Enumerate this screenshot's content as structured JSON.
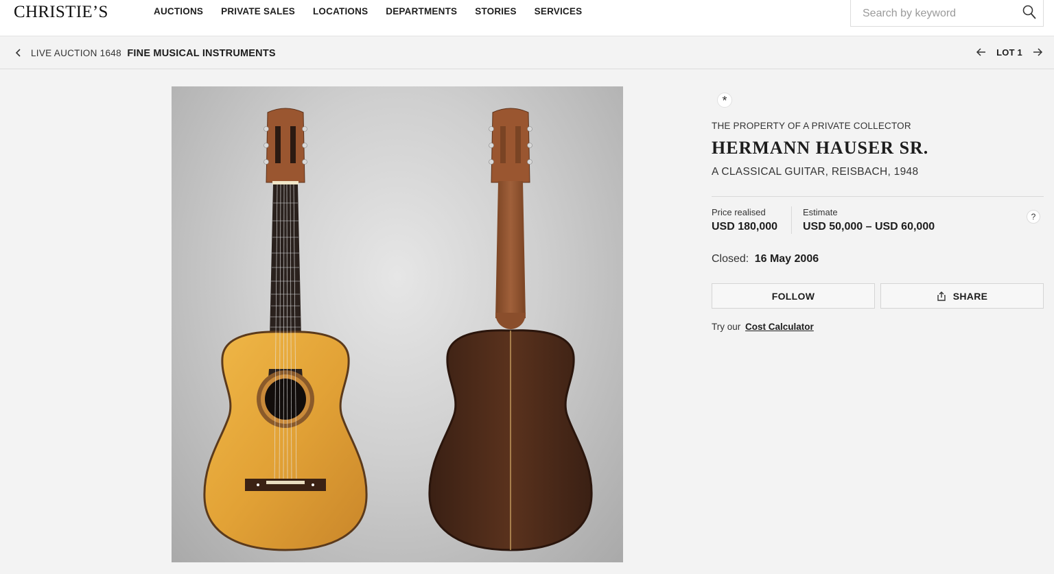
{
  "header": {
    "logo": "CHRISTIE’S",
    "nav": [
      "AUCTIONS",
      "PRIVATE SALES",
      "LOCATIONS",
      "DEPARTMENTS",
      "STORIES",
      "SERVICES"
    ],
    "search": {
      "placeholder": "Search by keyword",
      "value": "",
      "icon": "search-icon"
    }
  },
  "breadcrumb": {
    "back_icon": "chevron-left-icon",
    "prefix": "LIVE AUCTION 1648",
    "title": "FINE MUSICAL INSTRUMENTS"
  },
  "lot_nav": {
    "prev_icon": "arrow-left-icon",
    "label": "LOT 1",
    "next_icon": "arrow-right-icon"
  },
  "image": {
    "alt_icon": "guitar-photo",
    "background": "#c9c9c9"
  },
  "lot": {
    "badge": "*",
    "provenance": "THE PROPERTY OF A PRIVATE COLLECTOR",
    "title": "HERMANN HAUSER SR.",
    "subtitle": "A CLASSICAL GUITAR, REISBACH, 1948",
    "price_label": "Price realised",
    "price_value": "USD 180,000",
    "estimate_label": "Estimate",
    "estimate_value": "USD 50,000 – USD 60,000",
    "help": "?",
    "closed_label": "Closed:",
    "closed_date": "16 May 2006",
    "follow_label": "FOLLOW",
    "share_label": "SHARE",
    "share_icon": "share-icon",
    "calc_prefix": "Try our",
    "calc_link": "Cost Calculator"
  },
  "colors": {
    "page_bg": "#f3f3f3",
    "header_bg": "#ffffff",
    "text": "#1d1d1d",
    "guitar_top": "#e0a53a",
    "guitar_back": "#4a2a1a"
  }
}
